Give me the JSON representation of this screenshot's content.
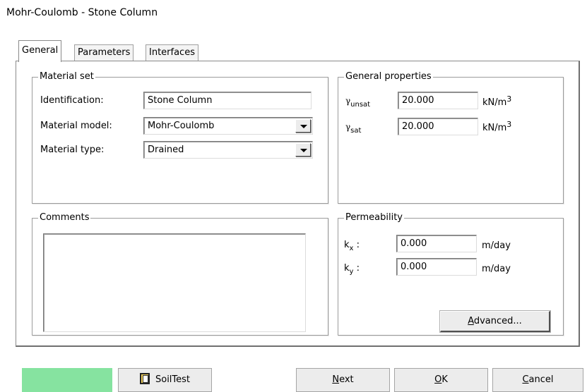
{
  "window": {
    "title": "Mohr-Coulomb - Stone Column"
  },
  "tabs": [
    {
      "label": "General"
    },
    {
      "label": "Parameters"
    },
    {
      "label": "Interfaces"
    }
  ],
  "material_set": {
    "title": "Material set",
    "identification": {
      "label": "Identification:",
      "value": "Stone Column"
    },
    "model": {
      "label": "Material model:",
      "value": "Mohr-Coulomb"
    },
    "type": {
      "label": "Material type:",
      "value": "Drained"
    }
  },
  "general_properties": {
    "title": "General properties",
    "gamma_symbol": "γ",
    "unsat": {
      "subscript": "unsat",
      "value": "20.000",
      "unit": "kN/m",
      "unit_power": "3"
    },
    "sat": {
      "subscript": "sat",
      "value": "20.000",
      "unit": "kN/m",
      "unit_power": "3"
    }
  },
  "comments": {
    "title": "Comments",
    "value": ""
  },
  "permeability": {
    "title": "Permeability",
    "kx": {
      "base": "k",
      "subscript": "x",
      "sep": " :",
      "value": "0.000",
      "unit": "m/day"
    },
    "ky": {
      "base": "k",
      "subscript": "y",
      "sep": " :",
      "value": "0.000",
      "unit": "m/day"
    },
    "advanced_prefix": "A",
    "advanced_rest": "dvanced..."
  },
  "footer": {
    "color_swatch": "#86e3a0",
    "soiltest_label": "SoilTest",
    "next": {
      "u": "N",
      "rest": "ext"
    },
    "ok": {
      "u": "O",
      "rest": "K"
    },
    "cancel": {
      "u": "C",
      "rest": "ancel"
    }
  }
}
